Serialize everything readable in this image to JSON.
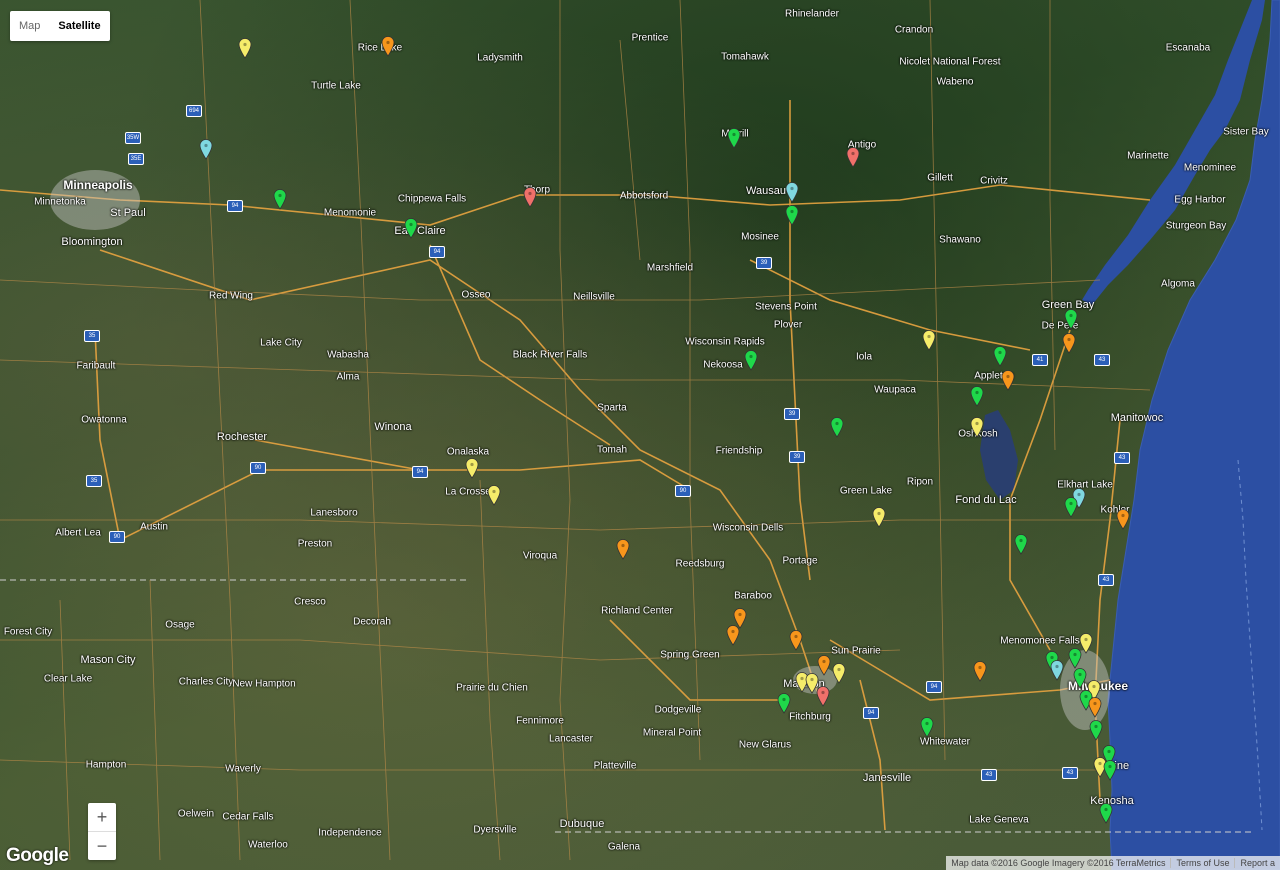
{
  "map": {
    "type_control": {
      "map_label": "Map",
      "satellite_label": "Satellite",
      "active": "Satellite"
    },
    "zoom": {
      "in_label": "+",
      "out_label": "−"
    },
    "logo": "Google",
    "attribution": {
      "data": "Map data ©2016 Google Imagery ©2016 TerraMetrics",
      "terms": "Terms of Use",
      "report": "Report a"
    },
    "colors": {
      "green": "#1fd84a",
      "orange": "#f7961c",
      "yellow": "#f5ec6a",
      "red": "#f0706a",
      "cyan": "#7fd8e0",
      "water": "#2b4fa6"
    }
  },
  "places": [
    {
      "name": "Minneapolis",
      "size": "big"
    },
    {
      "name": "St Paul",
      "size": "mid"
    },
    {
      "name": "Minnetonka",
      "size": "sm"
    },
    {
      "name": "Bloomington",
      "size": "mid"
    },
    {
      "name": "Rice Lake",
      "size": "sm"
    },
    {
      "name": "Ladysmith",
      "size": "sm"
    },
    {
      "name": "Prentice",
      "size": "sm"
    },
    {
      "name": "Rhinelander",
      "size": "sm"
    },
    {
      "name": "Crandon",
      "size": "sm"
    },
    {
      "name": "Nicolet National Forest",
      "size": "sm"
    },
    {
      "name": "Wabeno",
      "size": "sm"
    },
    {
      "name": "Escanaba",
      "size": "sm"
    },
    {
      "name": "Marinette",
      "size": "sm"
    },
    {
      "name": "Menominee",
      "size": "sm"
    },
    {
      "name": "Egg Harbor",
      "size": "sm"
    },
    {
      "name": "Sister Bay",
      "size": "sm"
    },
    {
      "name": "Sturgeon Bay",
      "size": "sm"
    },
    {
      "name": "Algoma",
      "size": "sm"
    },
    {
      "name": "Green Bay",
      "size": "mid"
    },
    {
      "name": "De Pere",
      "size": "sm"
    },
    {
      "name": "Appleton",
      "size": "sm"
    },
    {
      "name": "Oshkosh",
      "size": "sm"
    },
    {
      "name": "Fond du Lac",
      "size": "mid"
    },
    {
      "name": "Manitowoc",
      "size": "mid"
    },
    {
      "name": "Kohler",
      "size": "sm"
    },
    {
      "name": "Elkhart Lake",
      "size": "sm"
    },
    {
      "name": "Milwaukee",
      "size": "big"
    },
    {
      "name": "Racine",
      "size": "mid"
    },
    {
      "name": "Kenosha",
      "size": "mid"
    },
    {
      "name": "Menomonee Falls",
      "size": "sm"
    },
    {
      "name": "Whitewater",
      "size": "sm"
    },
    {
      "name": "Janesville",
      "size": "mid"
    },
    {
      "name": "Lake Geneva",
      "size": "sm"
    },
    {
      "name": "Madison",
      "size": "mid"
    },
    {
      "name": "Fitchburg",
      "size": "sm"
    },
    {
      "name": "Sun Prairie",
      "size": "sm"
    },
    {
      "name": "Baraboo",
      "size": "sm"
    },
    {
      "name": "Portage",
      "size": "sm"
    },
    {
      "name": "Reedsburg",
      "size": "sm"
    },
    {
      "name": "Wisconsin Dells",
      "size": "sm"
    },
    {
      "name": "New Glarus",
      "size": "sm"
    },
    {
      "name": "Mineral Point",
      "size": "sm"
    },
    {
      "name": "Dodgeville",
      "size": "sm"
    },
    {
      "name": "Spring Green",
      "size": "sm"
    },
    {
      "name": "Richland Center",
      "size": "sm"
    },
    {
      "name": "Viroqua",
      "size": "sm"
    },
    {
      "name": "La Crosse",
      "size": "sm"
    },
    {
      "name": "Onalaska",
      "size": "sm"
    },
    {
      "name": "Tomah",
      "size": "sm"
    },
    {
      "name": "Sparta",
      "size": "sm"
    },
    {
      "name": "Black River Falls",
      "size": "sm"
    },
    {
      "name": "Neillsville",
      "size": "sm"
    },
    {
      "name": "Marshfield",
      "size": "sm"
    },
    {
      "name": "Wisconsin Rapids",
      "size": "sm"
    },
    {
      "name": "Stevens Point",
      "size": "sm"
    },
    {
      "name": "Plover",
      "size": "sm"
    },
    {
      "name": "Wausau",
      "size": "mid"
    },
    {
      "name": "Mosinee",
      "size": "sm"
    },
    {
      "name": "Merrill",
      "size": "sm"
    },
    {
      "name": "Tomahawk",
      "size": "sm"
    },
    {
      "name": "Antigo",
      "size": "sm"
    },
    {
      "name": "Shawano",
      "size": "sm"
    },
    {
      "name": "Gillett",
      "size": "sm"
    },
    {
      "name": "Thorp",
      "size": "sm"
    },
    {
      "name": "Abbotsford",
      "size": "sm"
    },
    {
      "name": "Chippewa Falls",
      "size": "sm"
    },
    {
      "name": "Eau Claire",
      "size": "mid"
    },
    {
      "name": "Menomonie",
      "size": "sm"
    },
    {
      "name": "Red Wing",
      "size": "sm"
    },
    {
      "name": "Lake City",
      "size": "sm"
    },
    {
      "name": "Wabasha",
      "size": "sm"
    },
    {
      "name": "Alma",
      "size": "sm"
    },
    {
      "name": "Winona",
      "size": "mid"
    },
    {
      "name": "Rochester",
      "size": "mid"
    },
    {
      "name": "Faribault",
      "size": "sm"
    },
    {
      "name": "Owatonna",
      "size": "sm"
    },
    {
      "name": "Austin",
      "size": "sm"
    },
    {
      "name": "Albert Lea",
      "size": "sm"
    },
    {
      "name": "Lanesboro",
      "size": "sm"
    },
    {
      "name": "Preston",
      "size": "sm"
    },
    {
      "name": "Cresco",
      "size": "sm"
    },
    {
      "name": "Decorah",
      "size": "sm"
    },
    {
      "name": "Osage",
      "size": "sm"
    },
    {
      "name": "Forest City",
      "size": "sm"
    },
    {
      "name": "Mason City",
      "size": "mid"
    },
    {
      "name": "Clear Lake",
      "size": "sm"
    },
    {
      "name": "Charles City",
      "size": "sm"
    },
    {
      "name": "New Hampton",
      "size": "sm"
    },
    {
      "name": "Hampton",
      "size": "sm"
    },
    {
      "name": "Waverly",
      "size": "sm"
    },
    {
      "name": "Cedar Falls",
      "size": "sm"
    },
    {
      "name": "Waterloo",
      "size": "sm"
    },
    {
      "name": "Independence",
      "size": "sm"
    },
    {
      "name": "Oelwein",
      "size": "sm"
    },
    {
      "name": "Dyersville",
      "size": "sm"
    },
    {
      "name": "Dubuque",
      "size": "mid"
    },
    {
      "name": "Galena",
      "size": "sm"
    },
    {
      "name": "Platteville",
      "size": "sm"
    },
    {
      "name": "Lancaster",
      "size": "sm"
    },
    {
      "name": "Fennimore",
      "size": "sm"
    },
    {
      "name": "Prairie du Chien",
      "size": "sm"
    },
    {
      "name": "Friendship",
      "size": "sm"
    },
    {
      "name": "Green Lake",
      "size": "sm"
    },
    {
      "name": "Ripon",
      "size": "sm"
    },
    {
      "name": "Waupaca",
      "size": "sm"
    },
    {
      "name": "Iola",
      "size": "sm"
    },
    {
      "name": "Nekoosa",
      "size": "sm"
    },
    {
      "name": "Osseo",
      "size": "sm"
    },
    {
      "name": "Turtle Lake",
      "size": "sm"
    },
    {
      "name": "Crivitz",
      "size": "sm"
    }
  ],
  "highways": [
    "35W",
    "35E",
    "694",
    "94",
    "94",
    "35",
    "35",
    "90",
    "90",
    "94",
    "90",
    "39",
    "39",
    "39",
    "43",
    "43",
    "43",
    "43",
    "94",
    "41",
    "94",
    "43"
  ]
}
